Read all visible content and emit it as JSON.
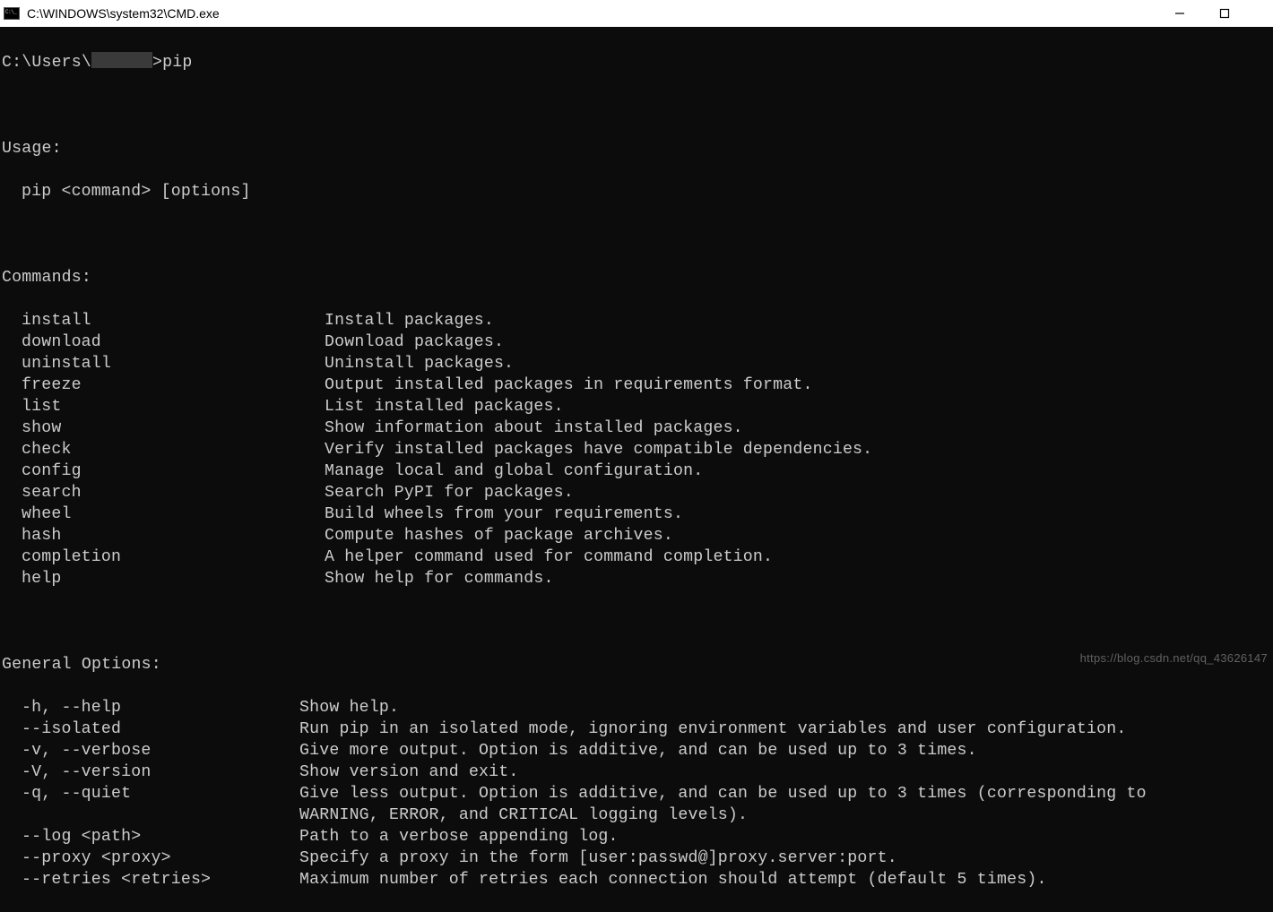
{
  "titlebar": {
    "title": "C:\\WINDOWS\\system32\\CMD.exe"
  },
  "terminal": {
    "prompt_prefix": "C:\\Users\\",
    "prompt_suffix": ">pip",
    "usage_header": "Usage:",
    "usage_text": "pip <command> [options]",
    "commands_header": "Commands:",
    "commands": [
      {
        "name": "install",
        "desc": "Install packages."
      },
      {
        "name": "download",
        "desc": "Download packages."
      },
      {
        "name": "uninstall",
        "desc": "Uninstall packages."
      },
      {
        "name": "freeze",
        "desc": "Output installed packages in requirements format."
      },
      {
        "name": "list",
        "desc": "List installed packages."
      },
      {
        "name": "show",
        "desc": "Show information about installed packages."
      },
      {
        "name": "check",
        "desc": "Verify installed packages have compatible dependencies."
      },
      {
        "name": "config",
        "desc": "Manage local and global configuration."
      },
      {
        "name": "search",
        "desc": "Search PyPI for packages."
      },
      {
        "name": "wheel",
        "desc": "Build wheels from your requirements."
      },
      {
        "name": "hash",
        "desc": "Compute hashes of package archives."
      },
      {
        "name": "completion",
        "desc": "A helper command used for command completion."
      },
      {
        "name": "help",
        "desc": "Show help for commands."
      }
    ],
    "options_header": "General Options:",
    "options": [
      {
        "flag": "-h, --help",
        "desc": "Show help."
      },
      {
        "flag": "--isolated",
        "desc": "Run pip in an isolated mode, ignoring environment variables and user configuration."
      },
      {
        "flag": "-v, --verbose",
        "desc": "Give more output. Option is additive, and can be used up to 3 times."
      },
      {
        "flag": "-V, --version",
        "desc": "Show version and exit."
      },
      {
        "flag": "-q, --quiet",
        "desc": "Give less output. Option is additive, and can be used up to 3 times (corresponding to"
      },
      {
        "flag": "",
        "desc": "WARNING, ERROR, and CRITICAL logging levels)."
      },
      {
        "flag": "--log <path>",
        "desc": "Path to a verbose appending log."
      },
      {
        "flag": "--proxy <proxy>",
        "desc": "Specify a proxy in the form [user:passwd@]proxy.server:port."
      },
      {
        "flag": "--retries <retries>",
        "desc": "Maximum number of retries each connection should attempt (default 5 times)."
      }
    ]
  },
  "watermark": "https://blog.csdn.net/qq_43626147"
}
